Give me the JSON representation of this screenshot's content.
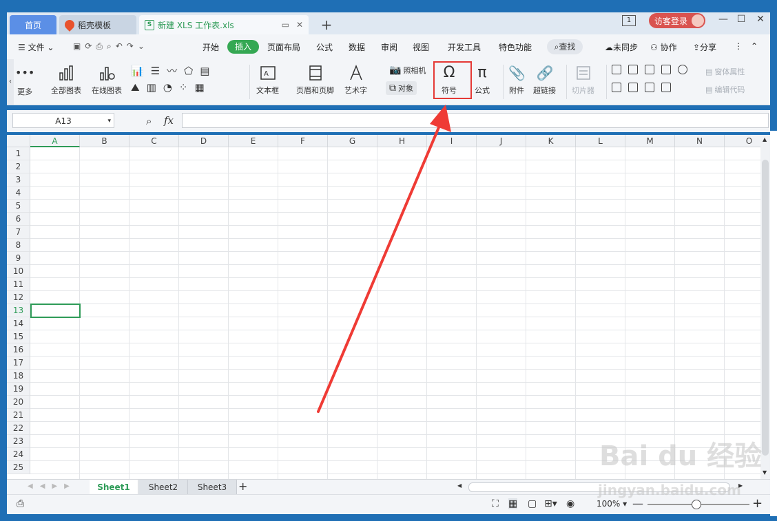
{
  "tabs": {
    "home": "首页",
    "template": "稻壳模板",
    "document": "新建 XLS 工作表.xls"
  },
  "titlebar": {
    "login": "访客登录",
    "badge": "1"
  },
  "menu": {
    "file": "文件",
    "items": [
      "开始",
      "插入",
      "页面布局",
      "公式",
      "数据",
      "审阅",
      "视图",
      "开发工具",
      "特色功能"
    ],
    "active": "插入",
    "search": "查找",
    "unsync": "未同步",
    "collab": "协作",
    "share": "分享"
  },
  "ribbon": {
    "more": "更多",
    "all_charts": "全部图表",
    "online_charts": "在线图表",
    "camera": "照相机",
    "object": "对象",
    "textbox": "文本框",
    "header_footer": "页眉和页脚",
    "wordart": "艺术字",
    "symbol": "符号",
    "formula": "公式",
    "attachment": "附件",
    "hyperlink": "超链接",
    "slicer": "切片器",
    "form_props": "窗体属性",
    "edit_code": "编辑代码"
  },
  "formula_bar": {
    "cell_ref": "A13",
    "fx": "fx",
    "value": ""
  },
  "grid": {
    "columns": [
      "A",
      "B",
      "C",
      "D",
      "E",
      "F",
      "G",
      "H",
      "I",
      "J",
      "K",
      "L",
      "M",
      "N",
      "O"
    ],
    "rows": [
      "1",
      "2",
      "3",
      "4",
      "5",
      "6",
      "7",
      "8",
      "9",
      "10",
      "11",
      "12",
      "13",
      "14",
      "15",
      "16",
      "17",
      "18",
      "19",
      "20",
      "21",
      "22",
      "23",
      "24",
      "25"
    ],
    "selected_cell": "A13"
  },
  "sheets": [
    "Sheet1",
    "Sheet2",
    "Sheet3"
  ],
  "active_sheet": "Sheet1",
  "status": {
    "zoom": "100%"
  },
  "watermark": {
    "brand": "Bai du 经验",
    "url": "jingyan.baidu.com"
  },
  "colors": {
    "accent_green": "#35a853",
    "highlight_red": "#e53935",
    "tab_blue": "#5b8fe6"
  }
}
